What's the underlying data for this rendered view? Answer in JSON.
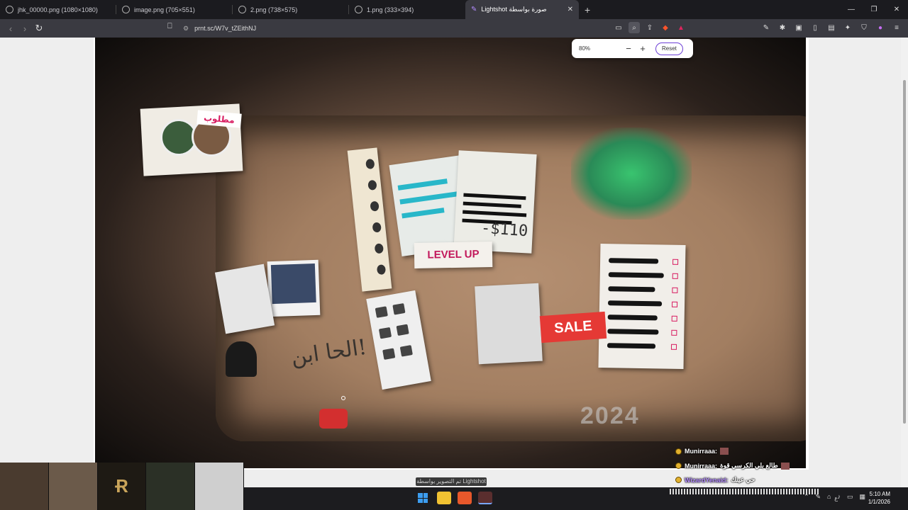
{
  "browser": {
    "tabs": [
      {
        "label": "jhk_00000.png (1080×1080)"
      },
      {
        "label": "image.png (705×551)"
      },
      {
        "label": "2.png (738×575)"
      },
      {
        "label": "1.png (333×394)"
      },
      {
        "label": "Lightshot صورة بواسطة",
        "active": true
      }
    ],
    "url": "prnt.sc/W7v_tZEithNJ"
  },
  "zoom_popup": {
    "level": "80%",
    "minus": "−",
    "plus": "+",
    "reset": "Reset"
  },
  "board": {
    "wanted_tag": "مطلوب",
    "price": "-$110",
    "level_up": "LEVEL UP",
    "sale": "SALE",
    "handwriting": "الحا ابن!",
    "year": "2024"
  },
  "chat": [
    {
      "user": "Munirraaa:",
      "text": ""
    },
    {
      "user": "Munirraaa:",
      "text": "طالع بلي الكرسي قوة"
    },
    {
      "user": "WizardYenaid:",
      "text": "حي عينك"
    }
  ],
  "taskbar": {
    "tooltip": "تم التصوير بواسطة Lightshot",
    "lang": "ع",
    "time": "5:10 AM",
    "date": "1/1/2026"
  },
  "colors": {
    "accent": "#6d3fd6",
    "brand_red": "#e53935",
    "pink": "#d81b60"
  }
}
